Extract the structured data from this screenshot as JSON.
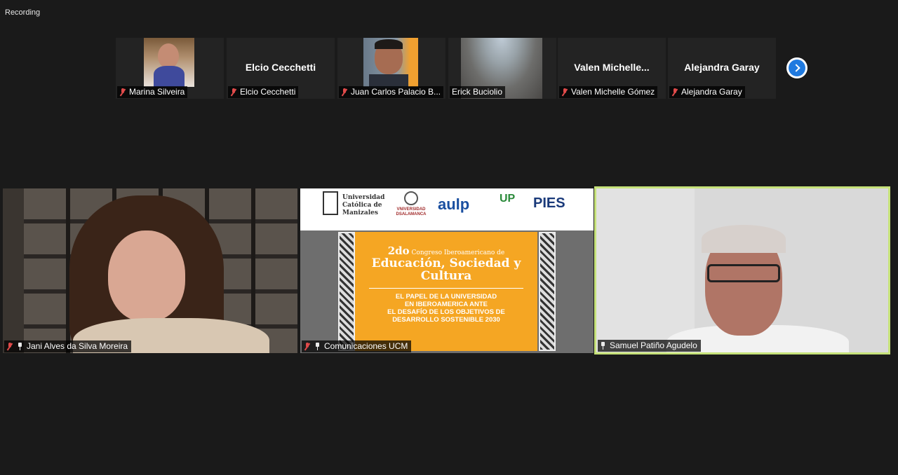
{
  "recording_label": "Recording",
  "thumbnails": [
    {
      "name": "Marina Silveira",
      "display": "",
      "muted": true,
      "kind": "photo"
    },
    {
      "name": "Elcio Cecchetti",
      "display": "Elcio Cecchetti",
      "muted": true,
      "kind": "text"
    },
    {
      "name": "Juan Carlos Palacio B...",
      "display": "",
      "muted": true,
      "kind": "photo"
    },
    {
      "name": "Erick Buciolio",
      "display": "",
      "muted": false,
      "kind": "photo"
    },
    {
      "name": "Valen Michelle Gómez",
      "display": "Valen  Michelle...",
      "muted": true,
      "kind": "text"
    },
    {
      "name": "Alejandra Garay",
      "display": "Alejandra Garay",
      "muted": true,
      "kind": "text"
    }
  ],
  "next_page_icon": "chevron-right-icon",
  "videos": [
    {
      "name": "Jani Alves da Silva Moreira",
      "muted": true,
      "pinned": true
    },
    {
      "name": "Comunicaciones UCM",
      "muted": true,
      "pinned": true
    },
    {
      "name": "Samuel Patiño Agudelo",
      "muted": false,
      "pinned": true,
      "active_speaker": true
    }
  ],
  "slide": {
    "logos": [
      "Universidad Católica de Manizales",
      "VNIVERSIDAD DSALAMANCA",
      "aulp",
      "UP",
      "PIES"
    ],
    "ordinal": "2do",
    "congress": "Congreso Iberoamericano de",
    "title": "Educación, Sociedad y Cultura",
    "subtitle_lines": [
      "EL PAPEL DE LA UNIVERSIDAD",
      "EN IBEROAMERICA ANTE",
      "EL DESAFÍO DE LOS OBJETIVOS DE",
      "DESARROLLO SOSTENIBLE 2030"
    ]
  },
  "colors": {
    "background": "#1a1a1a",
    "active_speaker_border": "#c6e27a",
    "muted_icon": "#e04a4a",
    "next_button": "#1f7ae0",
    "slide_orange": "#f5a623"
  }
}
